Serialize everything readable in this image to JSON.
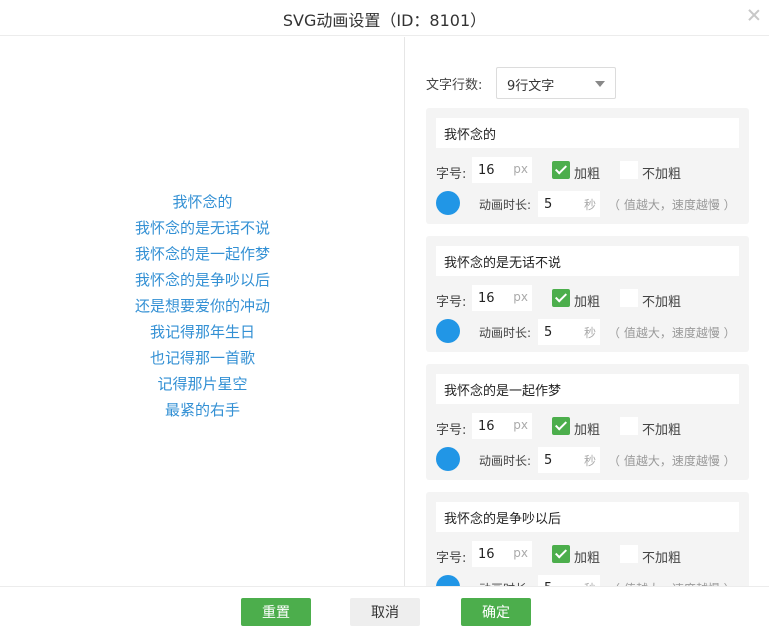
{
  "dialog": {
    "title": "SVG动画设置（ID：8101）"
  },
  "preview": {
    "color": "#3390d4",
    "lines": [
      "我怀念的",
      "我怀念的是无话不说",
      "我怀念的是一起作梦",
      "我怀念的是争吵以后",
      "还是想要爱你的冲动",
      "我记得那年生日",
      "也记得那一首歌",
      "记得那片星空",
      "最紧的右手"
    ]
  },
  "settings": {
    "rows_label": "文字行数:",
    "rows_value": "9行文字",
    "labels": {
      "size": "字号:",
      "size_unit": "px",
      "bold": "加粗",
      "not_bold": "不加粗",
      "duration": "动画时长:",
      "duration_unit": "秒",
      "duration_hint": "（ 值越大，速度越慢 ）"
    },
    "dot_color": "#2196e6",
    "check_color": "#4cae4c",
    "cards": [
      {
        "text": "我怀念的",
        "size": "16",
        "duration": "5",
        "bold": true
      },
      {
        "text": "我怀念的是无话不说",
        "size": "16",
        "duration": "5",
        "bold": true
      },
      {
        "text": "我怀念的是一起作梦",
        "size": "16",
        "duration": "5",
        "bold": true
      },
      {
        "text": "我怀念的是争吵以后",
        "size": "16",
        "duration": "5",
        "bold": true
      }
    ]
  },
  "footer": {
    "reset_label": "重置",
    "cancel_label": "取消",
    "ok_label": "确定"
  }
}
